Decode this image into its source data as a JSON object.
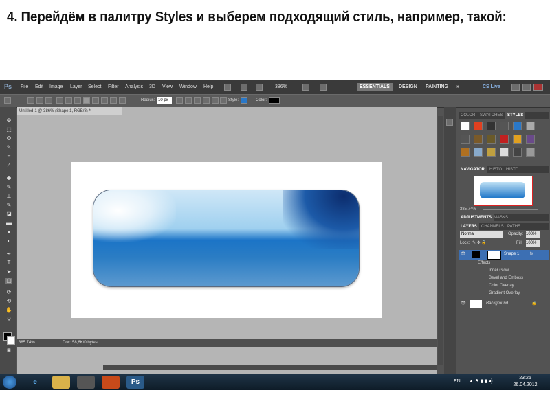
{
  "slide": {
    "title": "4. Перейдём в палитру Styles и выберем подходящий стиль, например, такой:"
  },
  "menubar": {
    "logo": "Ps",
    "items": [
      "File",
      "Edit",
      "Image",
      "Layer",
      "Select",
      "Filter",
      "Analysis",
      "3D",
      "View",
      "Window",
      "Help"
    ],
    "zoom": "386%",
    "workspaces": [
      "ESSENTIALS",
      "DESIGN",
      "PAINTING"
    ],
    "more": "»",
    "cslive": "CS Live"
  },
  "options": {
    "radius_label": "Radius:",
    "radius_value": "10 px",
    "style_label": "Style:",
    "color_label": "Color:"
  },
  "document": {
    "tab_title": "Untitled-1 @ 386% (Shape 1, RGB/8) *",
    "status_zoom": "385.74%",
    "status_doc": "Doc: 58,6K/0 bytes"
  },
  "panels": {
    "top_tabs": [
      "COLOR",
      "SWATCHES",
      "STYLES"
    ],
    "nav_tabs": [
      "NAVIGATOR",
      "HISTO",
      "HISTO"
    ],
    "nav_zoom": "385.74%",
    "adj_tabs": [
      "ADJUSTMENTS",
      "MASKS"
    ],
    "layer_tabs": [
      "LAYERS",
      "CHANNELS",
      "PATHS"
    ],
    "blend_mode": "Normal",
    "opacity_label": "Opacity:",
    "opacity_value": "100%",
    "lock_label": "Lock:",
    "fill_label": "Fill:",
    "fill_value": "100%",
    "layers": {
      "shape": "Shape 1",
      "effects": "Effects",
      "effect_items": [
        "Inner Glow",
        "Bevel and Emboss",
        "Color Overlay",
        "Gradient Overlay"
      ],
      "background": "Background"
    }
  },
  "taskbar": {
    "lang": "EN",
    "time": "23:25",
    "date": "26.04.2012",
    "ps_label": "Ps"
  },
  "colors": {
    "accent": "#1b74c7",
    "ps_bg": "#535353"
  }
}
